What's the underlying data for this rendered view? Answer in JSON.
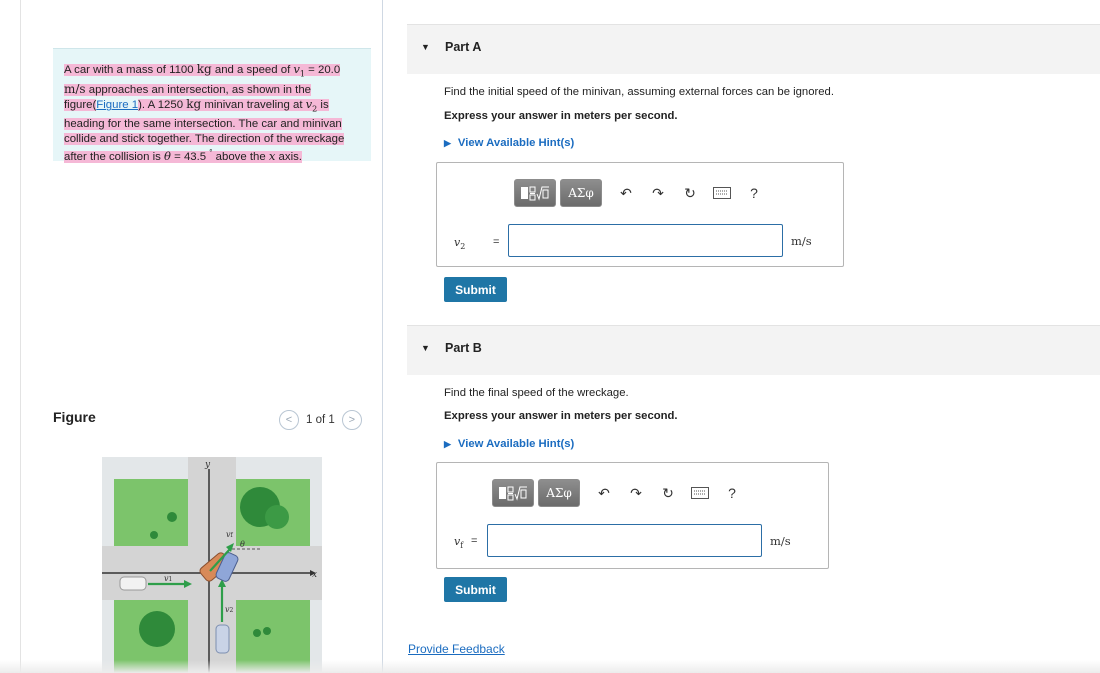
{
  "problem": {
    "t1": "A car with a mass of 1100 ",
    "kg1": "kg",
    "t2": " and a speed of ",
    "v1sym": "v",
    "v1sub": "1",
    "t3": " = 20.0 ",
    "ms1": "m/s",
    "t4": " approaches an intersection, as shown in the figure(",
    "link": "Figure 1",
    "t5": "). A 1250 ",
    "kg2": "kg",
    "t6": " minivan traveling at ",
    "v2sym": "v",
    "v2sub": "2",
    "t7": " is heading for the same intersection. The car and minivan collide and stick together. The direction of the wreckage after the collision is ",
    "theta": "θ",
    "t8": " = 43.5 ",
    "deg": "°",
    "t9": " above the ",
    "xsym": "x",
    "t10": " axis."
  },
  "figure": {
    "title": "Figure",
    "pager_prev": "<",
    "pager_text": "1 of 1",
    "pager_next": ">",
    "labels": {
      "y": "y",
      "x": "x",
      "v1": "v",
      "v1_sub": "1",
      "v2": "v",
      "v2_sub": "2",
      "vf": "v",
      "vf_sub": "f",
      "theta": "θ"
    },
    "colors": {
      "grass": "#7cc46b",
      "road": "#d4d4d4",
      "background": "#e3e7e9",
      "arrow": "#2e9e4a"
    }
  },
  "partA": {
    "title": "Part A",
    "question": "Find the initial speed of the minivan, assuming external forces can be ignored.",
    "instruction": "Express your answer in meters per second.",
    "hint": "View Available Hint(s)",
    "var": "v",
    "var_sub": "2",
    "eq": "=",
    "value": "",
    "unit": "m/s",
    "submit": "Submit"
  },
  "partB": {
    "title": "Part B",
    "question": "Find the final speed of the wreckage.",
    "instruction": "Express your answer in meters per second.",
    "hint": "View Available Hint(s)",
    "var": "v",
    "var_sub": "f",
    "eq": "=",
    "value": "",
    "unit": "m/s",
    "submit": "Submit"
  },
  "toolbar": {
    "template_icon": "template-icon",
    "greek": "ΑΣφ",
    "undo_icon": "undo-icon",
    "redo_icon": "redo-icon",
    "reset_icon": "reset-icon",
    "keyboard_icon": "keyboard-icon",
    "help": "?"
  },
  "feedback": "Provide Feedback",
  "colors": {
    "accent": "#1b6cc0",
    "submit": "#1f76a6",
    "highlight": "#f5b8d6",
    "problem_bg": "#e6f6f8"
  }
}
